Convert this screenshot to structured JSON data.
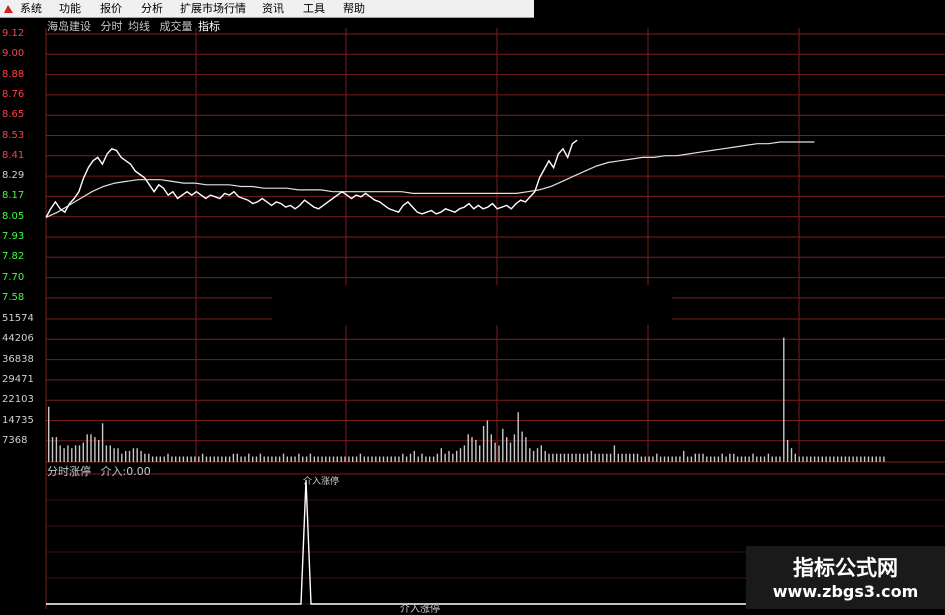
{
  "menu": {
    "items": [
      "系统",
      "功能",
      "报价",
      "分析",
      "扩展市场行情",
      "资讯",
      "工具",
      "帮助"
    ]
  },
  "stock_header": {
    "name": "海岛建设",
    "tabs": [
      "分时",
      "均线",
      "成交量",
      "指标"
    ]
  },
  "volume_panel": {
    "title": "分时涨停",
    "entry_label": "介入:0.00"
  },
  "pulse_label": "介入涨停",
  "bottom_label": "介入涨停",
  "watermark": {
    "title": "指标公式网",
    "url": "www.zbgs3.com"
  },
  "colors": {
    "background": "#000000",
    "grid": "#7a1e1e",
    "price_up": "#ff4040",
    "price_down": "#40ff40",
    "price_line": "#ffffff",
    "avg_line": "#e0e0e0",
    "volume_bar": "#c8c8c8"
  },
  "chart_data": {
    "type": "line",
    "price_axis_labels": [
      "9.12",
      "9.00",
      "8.88",
      "8.76",
      "8.65",
      "8.53",
      "8.41",
      "8.29",
      "8.17",
      "8.05",
      "7.93",
      "7.82",
      "7.70",
      "7.58"
    ],
    "volume_axis_labels": [
      "51574",
      "44206",
      "36838",
      "29471",
      "22103",
      "14735",
      "7368"
    ],
    "ylim": [
      7.58,
      9.12
    ],
    "volume_ylim": [
      0,
      58942
    ],
    "x_points": 241,
    "series": [
      {
        "values": [
          8.05,
          8.1,
          8.14,
          8.1,
          8.08,
          8.13,
          8.16,
          8.2,
          8.28,
          8.34,
          8.38,
          8.4,
          8.36,
          8.42,
          8.45,
          8.44,
          8.4,
          8.38,
          8.36,
          8.32,
          8.3,
          8.28,
          8.24,
          8.2,
          8.24,
          8.22,
          8.18,
          8.2,
          8.16,
          8.18,
          8.2,
          8.18,
          8.2,
          8.18,
          8.16,
          8.18,
          8.17,
          8.16,
          8.19,
          8.18,
          8.2,
          8.17,
          8.16,
          8.15,
          8.13,
          8.14,
          8.16,
          8.14,
          8.12,
          8.14,
          8.13,
          8.11,
          8.12,
          8.1,
          8.12,
          8.15,
          8.13,
          8.11,
          8.1,
          8.12,
          8.14,
          8.16,
          8.18,
          8.2,
          8.18,
          8.16,
          8.18,
          8.17,
          8.19,
          8.17,
          8.15,
          8.14,
          8.12,
          8.1,
          8.09,
          8.08,
          8.12,
          8.14,
          8.11,
          8.08,
          8.07,
          8.08,
          8.09,
          8.07,
          8.08,
          8.1,
          8.09,
          8.08,
          8.1,
          8.11,
          8.13,
          8.1,
          8.12,
          8.1,
          8.11,
          8.13,
          8.1,
          8.11,
          8.12,
          8.1,
          8.13,
          8.15,
          8.14,
          8.17,
          8.2,
          8.28,
          8.33,
          8.38,
          8.34,
          8.42,
          8.45,
          8.4,
          8.48,
          8.5
        ],
        "x_end": 114
      },
      {
        "values": [
          8.05,
          8.08,
          8.12,
          8.16,
          8.2,
          8.23,
          8.25,
          8.26,
          8.27,
          8.27,
          8.27,
          8.26,
          8.25,
          8.25,
          8.24,
          8.24,
          8.24,
          8.23,
          8.23,
          8.22,
          8.22,
          8.22,
          8.21,
          8.21,
          8.21,
          8.2,
          8.2,
          8.2,
          8.2,
          8.2,
          8.2,
          8.2,
          8.19,
          8.19,
          8.19,
          8.19,
          8.19,
          8.19,
          8.19,
          8.19,
          8.19,
          8.19,
          8.2,
          8.21,
          8.23,
          8.26,
          8.29,
          8.32,
          8.35,
          8.37,
          8.38,
          8.39,
          8.4,
          8.4,
          8.41,
          8.41,
          8.42,
          8.43,
          8.44,
          8.45,
          8.46,
          8.47,
          8.48,
          8.48,
          8.49,
          8.49,
          8.49,
          8.49
        ],
        "x_step": 3.6,
        "dashed": false
      }
    ],
    "volume": [
      20000,
      9000,
      9000,
      6000,
      5000,
      6000,
      5000,
      6000,
      6000,
      7000,
      10000,
      10000,
      9000,
      8000,
      14000,
      6000,
      6000,
      5000,
      5000,
      3000,
      4000,
      4000,
      5000,
      5000,
      4000,
      3000,
      3000,
      2000,
      2000,
      2000,
      2000,
      3000,
      2000,
      2000,
      2000,
      2000,
      2000,
      2000,
      2000,
      2000,
      3000,
      2000,
      2000,
      2000,
      2000,
      2000,
      2000,
      2000,
      3000,
      3000,
      2000,
      2000,
      3000,
      2000,
      2000,
      3000,
      2000,
      2000,
      2000,
      2000,
      2000,
      3000,
      2000,
      2000,
      2000,
      3000,
      2000,
      2000,
      3000,
      2000,
      2000,
      2000,
      2000,
      2000,
      2000,
      2000,
      2000,
      2000,
      2000,
      2000,
      2000,
      3000,
      2000,
      2000,
      2000,
      2000,
      2000,
      2000,
      2000,
      2000,
      2000,
      2000,
      3000,
      2000,
      3000,
      4000,
      2000,
      3000,
      2000,
      2000,
      2000,
      3000,
      5000,
      3000,
      4000,
      3000,
      4000,
      5000,
      6000,
      10000,
      9000,
      8000,
      6000,
      13000,
      15000,
      10000,
      7000,
      6000,
      12000,
      9000,
      7000,
      10000,
      18000,
      11000,
      9000,
      5000,
      4000,
      5000,
      6000,
      4000,
      3000,
      3000,
      3000,
      3000,
      3000,
      3000,
      3000,
      3000,
      3000,
      3000,
      3000,
      4000,
      3000,
      3000,
      3000,
      3000,
      3000,
      6000,
      3000,
      3000,
      3000,
      3000,
      3000,
      3000,
      2000,
      2000,
      2000,
      2000,
      3000,
      2000,
      2000,
      2000,
      2000,
      2000,
      2000,
      4000,
      2000,
      2000,
      3000,
      3000,
      3000,
      2000,
      2000,
      2000,
      2000,
      3000,
      2000,
      3000,
      3000,
      2000,
      2000,
      2000,
      2000,
      3000,
      2000,
      2000,
      2000,
      3000,
      2000,
      2000,
      2000,
      45000,
      8000,
      5000,
      3000,
      2000,
      2000,
      2000,
      2000,
      2000,
      2000,
      2000,
      2000,
      2000,
      2000,
      2000,
      2000,
      2000,
      2000,
      2000,
      2000,
      2000,
      2000,
      2000,
      2000,
      2000,
      2000,
      2000
    ],
    "pulse_index": 72,
    "pulse_value": 1.0
  }
}
